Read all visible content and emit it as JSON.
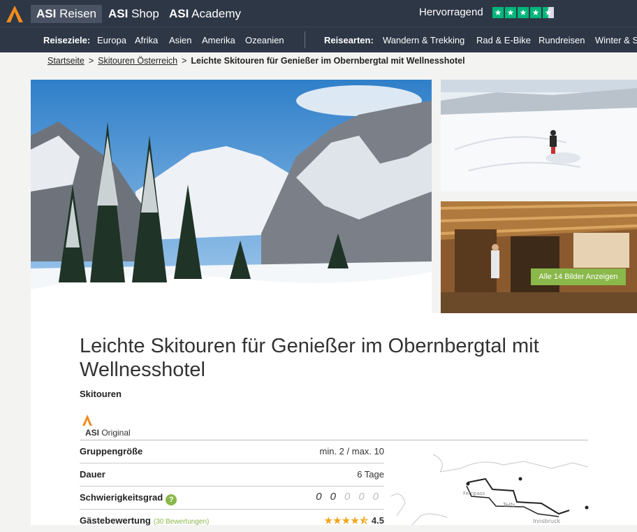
{
  "header": {
    "brands": [
      {
        "bold": "ASI",
        "rest": " Reisen"
      },
      {
        "bold": "ASI",
        "rest": " Shop"
      },
      {
        "bold": "ASI",
        "rest": " Academy"
      }
    ],
    "trust_label": "Hervorragend",
    "trust_stars": 4.5,
    "colors": {
      "bar": "#2e3746",
      "accent": "#f28c1e",
      "green": "#8ab84a",
      "trustpilot": "#00b67a"
    }
  },
  "nav": {
    "destinations_label": "Reiseziele:",
    "destinations": [
      "Europa",
      "Afrika",
      "Asien",
      "Amerika",
      "Ozeanien"
    ],
    "types_label": "Reisearten:",
    "types": [
      "Wandern & Trekking",
      "Rad & E-Bike",
      "Rundreisen",
      "Winter & S"
    ]
  },
  "breadcrumb": {
    "items": [
      "Startseite",
      "Skitouren Österreich"
    ],
    "current": "Leichte Skitouren für Genießer im Obernbergtal mit Wellnesshotel"
  },
  "gallery": {
    "all_button": "Alle 14 Bilder Anzeigen"
  },
  "tour": {
    "title": "Leichte Skitouren für Genießer im Obernbergtal mit Wellnesshotel",
    "category": "Skitouren",
    "original_bold": "ASI",
    "original_rest": " Original",
    "facts": {
      "group_label": "Gruppengröße",
      "group_value": "min. 2 / max. 10",
      "duration_label": "Dauer",
      "duration_value": "6 Tage",
      "difficulty_label": "Schwierigkeitsgrad",
      "difficulty_help": "?",
      "difficulty_level": 2,
      "difficulty_max": 5,
      "rating_label": "Gästebewertung",
      "rating_reviews": "(30 Bewertungen)",
      "rating_value": "4.5",
      "rating_stars": "★★★★⯪"
    }
  },
  "map": {
    "labels": [
      "Fernpass",
      "Telfs",
      "Innsbruck"
    ]
  }
}
